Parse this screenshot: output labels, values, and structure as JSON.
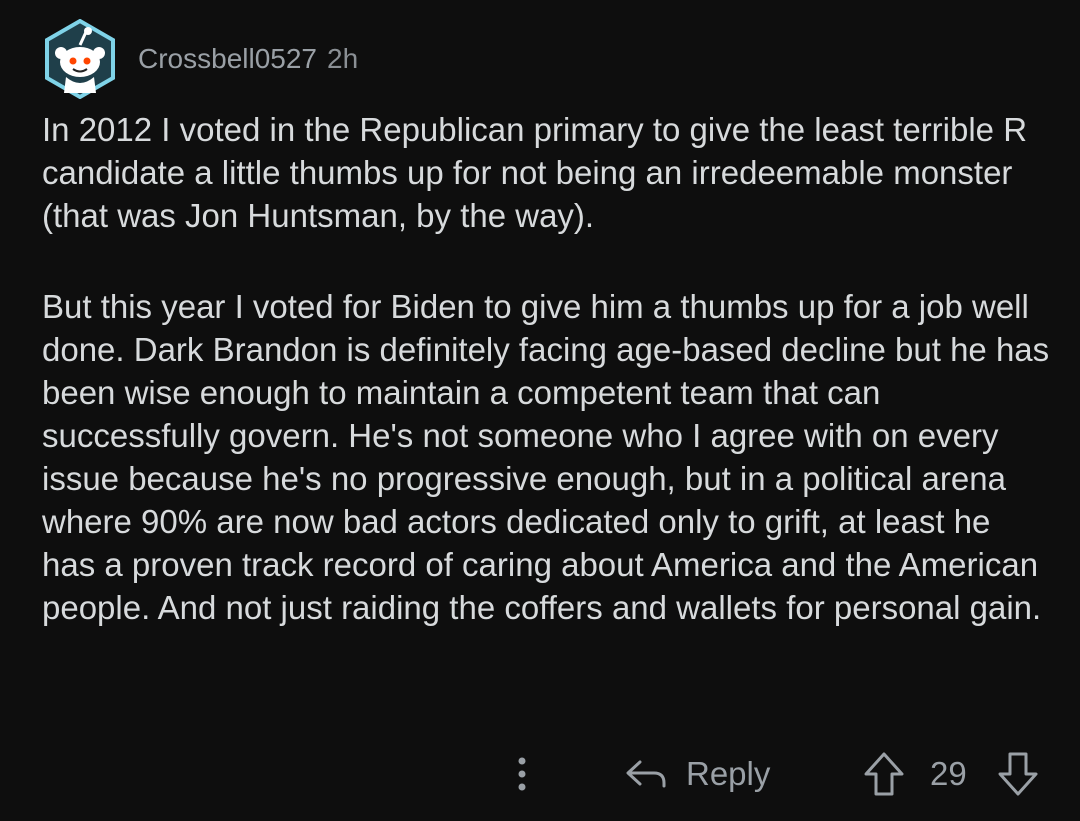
{
  "comment": {
    "author": "Crossbell0527",
    "time": "2h",
    "paragraphs": [
      "In 2012 I voted in the Republican primary to give the least terrible R candidate a little thumbs up for not being an irredeemable monster (that was Jon Huntsman, by the way).",
      "But this year I voted for Biden to give him a thumbs up for a job well done. Dark Brandon is definitely facing age-based decline but he has been wise enough to maintain a competent team that can successfully govern. He's not someone who I agree with on every issue because he's no progressive enough, but in a political arena where 90% are now bad actors dedicated only to grift, at least he has a proven track record of caring about America and the American people. And not just raiding the coffers and wallets for personal gain."
    ],
    "score": "29"
  },
  "actions": {
    "reply_label": "Reply"
  },
  "icons": {
    "avatar": "reddit-snoo-avatar-icon",
    "more": "more-options-icon",
    "reply": "reply-arrow-icon",
    "upvote": "upvote-arrow-icon",
    "downvote": "downvote-arrow-icon"
  },
  "colors": {
    "background": "#0e0e0e",
    "text": "#d7dadc",
    "muted": "#9aa0a6",
    "avatar_ring": "#7fd3e8"
  }
}
